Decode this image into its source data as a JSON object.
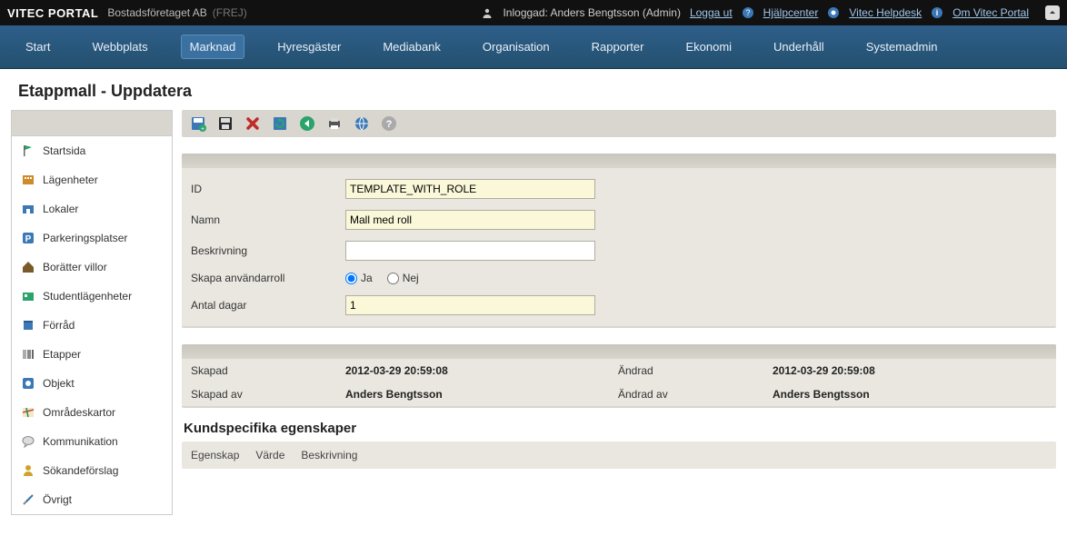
{
  "topbar": {
    "brand": "VITEC PORTAL",
    "company": "Bostadsföretaget AB",
    "system": "(FREJ)",
    "logged_prefix": "Inloggad: ",
    "logged_user": "Anders Bengtsson (Admin)",
    "logout": "Logga ut",
    "help_center": "Hjälpcenter",
    "helpdesk": "Vitec Helpdesk",
    "about": "Om Vitec Portal"
  },
  "nav": {
    "items": [
      "Start",
      "Webbplats",
      "Marknad",
      "Hyresgäster",
      "Mediabank",
      "Organisation",
      "Rapporter",
      "Ekonomi",
      "Underhåll",
      "Systemadmin"
    ],
    "active_index": 2
  },
  "page": {
    "title": "Etappmall - Uppdatera"
  },
  "sidebar": {
    "items": [
      {
        "label": "Startsida",
        "icon_color": "#2aa46a"
      },
      {
        "label": "Lägenheter",
        "icon_color": "#d08a2a"
      },
      {
        "label": "Lokaler",
        "icon_color": "#3b78b5"
      },
      {
        "label": "Parkeringsplatser",
        "icon_color": "#3b78b5"
      },
      {
        "label": "Borätter villor",
        "icon_color": "#7a5a2a"
      },
      {
        "label": "Studentlägenheter",
        "icon_color": "#2aa46a"
      },
      {
        "label": "Förråd",
        "icon_color": "#3b78b5"
      },
      {
        "label": "Etapper",
        "icon_color": "#6a6a6a"
      },
      {
        "label": "Objekt",
        "icon_color": "#3b78b5"
      },
      {
        "label": "Områdeskartor",
        "icon_color": "#c4483a"
      },
      {
        "label": "Kommunikation",
        "icon_color": "#6a6a6a"
      },
      {
        "label": "Sökandeförslag",
        "icon_color": "#d0a22a"
      },
      {
        "label": "Övrigt",
        "icon_color": "#6a6a6a"
      }
    ]
  },
  "form": {
    "fields": {
      "id_label": "ID",
      "id_value": "TEMPLATE_WITH_ROLE",
      "name_label": "Namn",
      "name_value": "Mall med roll",
      "desc_label": "Beskrivning",
      "desc_value": "",
      "role_label": "Skapa användarroll",
      "yes": "Ja",
      "no": "Nej",
      "days_label": "Antal dagar",
      "days_value": "1"
    },
    "meta": {
      "created_label": "Skapad",
      "created_value": "2012-03-29 20:59:08",
      "created_by_label": "Skapad av",
      "created_by_value": "Anders Bengtsson",
      "changed_label": "Ändrad",
      "changed_value": "2012-03-29 20:59:08",
      "changed_by_label": "Ändrad av",
      "changed_by_value": "Anders Bengtsson"
    }
  },
  "props": {
    "title": "Kundspecifika egenskaper",
    "cols": [
      "Egenskap",
      "Värde",
      "Beskrivning"
    ]
  }
}
